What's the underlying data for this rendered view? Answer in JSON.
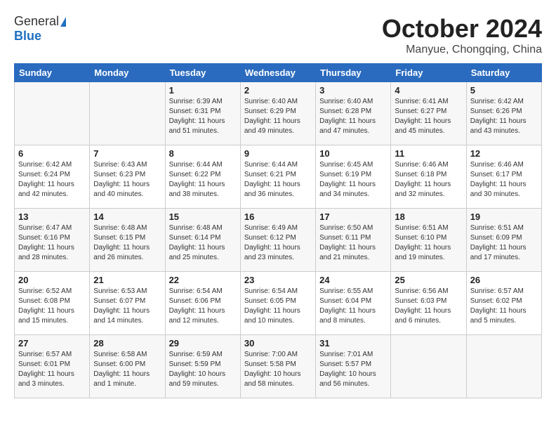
{
  "header": {
    "logo_general": "General",
    "logo_blue": "Blue",
    "month": "October 2024",
    "location": "Manyue, Chongqing, China"
  },
  "days_of_week": [
    "Sunday",
    "Monday",
    "Tuesday",
    "Wednesday",
    "Thursday",
    "Friday",
    "Saturday"
  ],
  "weeks": [
    [
      {
        "day": "",
        "info": ""
      },
      {
        "day": "",
        "info": ""
      },
      {
        "day": "1",
        "info": "Sunrise: 6:39 AM\nSunset: 6:31 PM\nDaylight: 11 hours and 51 minutes."
      },
      {
        "day": "2",
        "info": "Sunrise: 6:40 AM\nSunset: 6:29 PM\nDaylight: 11 hours and 49 minutes."
      },
      {
        "day": "3",
        "info": "Sunrise: 6:40 AM\nSunset: 6:28 PM\nDaylight: 11 hours and 47 minutes."
      },
      {
        "day": "4",
        "info": "Sunrise: 6:41 AM\nSunset: 6:27 PM\nDaylight: 11 hours and 45 minutes."
      },
      {
        "day": "5",
        "info": "Sunrise: 6:42 AM\nSunset: 6:26 PM\nDaylight: 11 hours and 43 minutes."
      }
    ],
    [
      {
        "day": "6",
        "info": "Sunrise: 6:42 AM\nSunset: 6:24 PM\nDaylight: 11 hours and 42 minutes."
      },
      {
        "day": "7",
        "info": "Sunrise: 6:43 AM\nSunset: 6:23 PM\nDaylight: 11 hours and 40 minutes."
      },
      {
        "day": "8",
        "info": "Sunrise: 6:44 AM\nSunset: 6:22 PM\nDaylight: 11 hours and 38 minutes."
      },
      {
        "day": "9",
        "info": "Sunrise: 6:44 AM\nSunset: 6:21 PM\nDaylight: 11 hours and 36 minutes."
      },
      {
        "day": "10",
        "info": "Sunrise: 6:45 AM\nSunset: 6:19 PM\nDaylight: 11 hours and 34 minutes."
      },
      {
        "day": "11",
        "info": "Sunrise: 6:46 AM\nSunset: 6:18 PM\nDaylight: 11 hours and 32 minutes."
      },
      {
        "day": "12",
        "info": "Sunrise: 6:46 AM\nSunset: 6:17 PM\nDaylight: 11 hours and 30 minutes."
      }
    ],
    [
      {
        "day": "13",
        "info": "Sunrise: 6:47 AM\nSunset: 6:16 PM\nDaylight: 11 hours and 28 minutes."
      },
      {
        "day": "14",
        "info": "Sunrise: 6:48 AM\nSunset: 6:15 PM\nDaylight: 11 hours and 26 minutes."
      },
      {
        "day": "15",
        "info": "Sunrise: 6:48 AM\nSunset: 6:14 PM\nDaylight: 11 hours and 25 minutes."
      },
      {
        "day": "16",
        "info": "Sunrise: 6:49 AM\nSunset: 6:12 PM\nDaylight: 11 hours and 23 minutes."
      },
      {
        "day": "17",
        "info": "Sunrise: 6:50 AM\nSunset: 6:11 PM\nDaylight: 11 hours and 21 minutes."
      },
      {
        "day": "18",
        "info": "Sunrise: 6:51 AM\nSunset: 6:10 PM\nDaylight: 11 hours and 19 minutes."
      },
      {
        "day": "19",
        "info": "Sunrise: 6:51 AM\nSunset: 6:09 PM\nDaylight: 11 hours and 17 minutes."
      }
    ],
    [
      {
        "day": "20",
        "info": "Sunrise: 6:52 AM\nSunset: 6:08 PM\nDaylight: 11 hours and 15 minutes."
      },
      {
        "day": "21",
        "info": "Sunrise: 6:53 AM\nSunset: 6:07 PM\nDaylight: 11 hours and 14 minutes."
      },
      {
        "day": "22",
        "info": "Sunrise: 6:54 AM\nSunset: 6:06 PM\nDaylight: 11 hours and 12 minutes."
      },
      {
        "day": "23",
        "info": "Sunrise: 6:54 AM\nSunset: 6:05 PM\nDaylight: 11 hours and 10 minutes."
      },
      {
        "day": "24",
        "info": "Sunrise: 6:55 AM\nSunset: 6:04 PM\nDaylight: 11 hours and 8 minutes."
      },
      {
        "day": "25",
        "info": "Sunrise: 6:56 AM\nSunset: 6:03 PM\nDaylight: 11 hours and 6 minutes."
      },
      {
        "day": "26",
        "info": "Sunrise: 6:57 AM\nSunset: 6:02 PM\nDaylight: 11 hours and 5 minutes."
      }
    ],
    [
      {
        "day": "27",
        "info": "Sunrise: 6:57 AM\nSunset: 6:01 PM\nDaylight: 11 hours and 3 minutes."
      },
      {
        "day": "28",
        "info": "Sunrise: 6:58 AM\nSunset: 6:00 PM\nDaylight: 11 hours and 1 minute."
      },
      {
        "day": "29",
        "info": "Sunrise: 6:59 AM\nSunset: 5:59 PM\nDaylight: 10 hours and 59 minutes."
      },
      {
        "day": "30",
        "info": "Sunrise: 7:00 AM\nSunset: 5:58 PM\nDaylight: 10 hours and 58 minutes."
      },
      {
        "day": "31",
        "info": "Sunrise: 7:01 AM\nSunset: 5:57 PM\nDaylight: 10 hours and 56 minutes."
      },
      {
        "day": "",
        "info": ""
      },
      {
        "day": "",
        "info": ""
      }
    ]
  ]
}
